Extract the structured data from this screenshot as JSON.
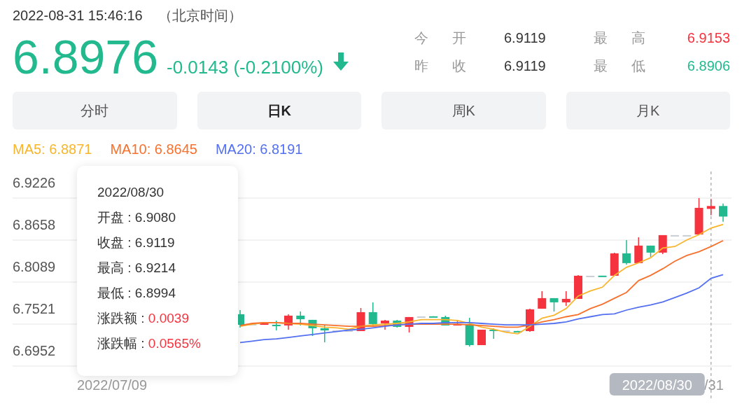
{
  "header": {
    "timestamp": "2022-08-31 15:46:16",
    "timezone": "（北京时间）",
    "price": "6.8976",
    "change": "-0.0143 (-0.2100%)",
    "color": "#23b98e"
  },
  "stats": [
    {
      "label": "今 开",
      "value": "6.9119",
      "color": "#333333"
    },
    {
      "label": "最 高",
      "value": "6.9153",
      "color": "#f5333f"
    },
    {
      "label": "昨 收",
      "value": "6.9119",
      "color": "#333333"
    },
    {
      "label": "最 低",
      "value": "6.8906",
      "color": "#23b98e"
    }
  ],
  "tabs": [
    {
      "label": "分时",
      "selected": false
    },
    {
      "label": "日K",
      "selected": true
    },
    {
      "label": "周K",
      "selected": false
    },
    {
      "label": "月K",
      "selected": false
    }
  ],
  "ma_legend": [
    {
      "label": "MA5: 6.8871",
      "color": "#f9b52c"
    },
    {
      "label": "MA10: 6.8645",
      "color": "#f7712d"
    },
    {
      "label": "MA20: 6.8191",
      "color": "#5470f0"
    }
  ],
  "chart": {
    "y_labels": [
      "6.9226",
      "6.8658",
      "6.8089",
      "6.7521",
      "6.6952"
    ],
    "x_labels": [
      "2022/07/09",
      "/31"
    ],
    "crosshair_label": "2022/08/30",
    "tooltip": {
      "date": "2022/08/30",
      "rows": [
        {
          "label": "开盘 : ",
          "value": "6.9080",
          "kind": "price"
        },
        {
          "label": "收盘 : ",
          "value": "6.9119",
          "kind": "price"
        },
        {
          "label": "最高 : ",
          "value": "6.9214",
          "kind": "price"
        },
        {
          "label": "最低 : ",
          "value": "6.8994",
          "kind": "price"
        },
        {
          "label": "涨跌额 : ",
          "value": "0.0039",
          "kind": "change"
        },
        {
          "label": "涨跌幅 : ",
          "value": "0.0565%",
          "kind": "change"
        }
      ]
    }
  }
}
